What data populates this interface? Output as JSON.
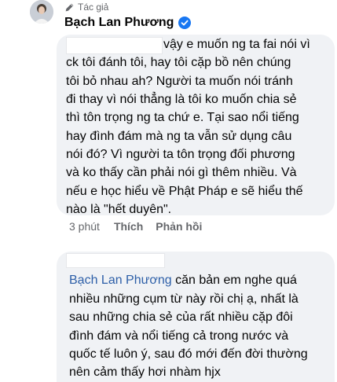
{
  "comment1": {
    "author_badge": "Tác giả",
    "author_name": "Bạch Lan Phương",
    "lines": [
      "vậy e muốn ng ta fai nói vì",
      "ck tôi đánh tôi, hay tôi cặp bồ nên chúng",
      "tôi bỏ nhau ah? Người ta muốn nói tránh",
      "đi thay vì nói thẳng là tôi ko muốn chia sẻ",
      "thì tôn trọng ng ta chứ e. Tại sao nổi tiếng",
      "hay đình đám mà ng ta vẫn sử dụng câu",
      "nói đó? Vì người ta tôn trọng đối phương",
      "và ko thấy cần phải nói gì thêm nhiều. Và",
      "nếu e học hiểu về Phật Pháp e sẽ hiểu thế",
      "nào là \"hết duyên\"."
    ],
    "time": "3 phút",
    "like_label": "Thích",
    "reply_label": "Phản hồi"
  },
  "comment2": {
    "mention": "Bạch Lan Phương",
    "first_line_rest": " căn bản em nghe quá",
    "lines": [
      "nhiều những cụm từ này rồi chị ạ, nhất là",
      "sau những chia sẻ của rất nhiều cặp đôi",
      "đình đám và nổi tiếng cả trong nước và",
      "quốc tế luôn ý, sau đó mới đến đời thường",
      "nên cảm thấy hơi nhàm hjx"
    ]
  },
  "colors": {
    "bubble": "#f0f2f5",
    "secondary_text": "#65676b",
    "mention": "#2d5fa8",
    "verified": "#1877f2"
  }
}
